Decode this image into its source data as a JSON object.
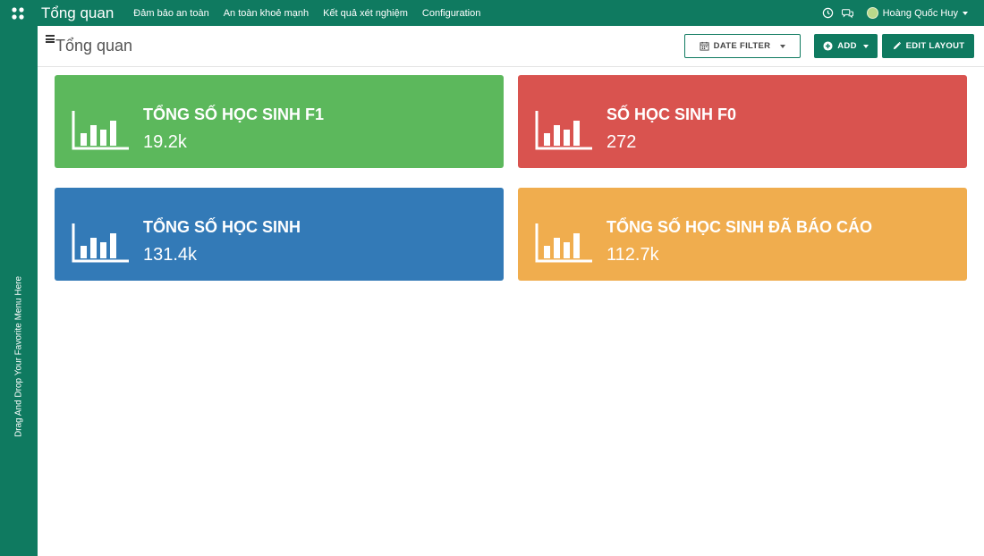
{
  "topbar": {
    "brand": "Tổng quan",
    "menu": [
      {
        "label": "Đảm bảo an toàn"
      },
      {
        "label": "An toàn khoẻ mạnh"
      },
      {
        "label": "Kết quả xét nghiệm"
      },
      {
        "label": "Configuration"
      }
    ],
    "user_name": "Hoàng Quốc Huy",
    "color": "#0f7a60"
  },
  "favorites": {
    "hint": "Drag And Drop Your Favorite Menu Here"
  },
  "control": {
    "title": "Tổng quan",
    "date_filter_label": "DATE FILTER",
    "add_label": "ADD",
    "edit_layout_label": "EDIT LAYOUT"
  },
  "cards": [
    {
      "label": "TỔNG SỐ HỌC SINH F1",
      "value": "19.2k",
      "color": "#5cb85c",
      "icon": "bar-chart-icon"
    },
    {
      "label": "SỐ HỌC SINH F0",
      "value": "272",
      "color": "#d9534f",
      "icon": "bar-chart-icon"
    },
    {
      "label": "TỔNG SỐ HỌC SINH",
      "value": "131.4k",
      "color": "#337ab7",
      "icon": "bar-chart-icon"
    },
    {
      "label": "TỔNG SỐ HỌC SINH ĐÃ BÁO CÁO",
      "value": "112.7k",
      "color": "#f0ad4e",
      "icon": "bar-chart-icon"
    }
  ]
}
